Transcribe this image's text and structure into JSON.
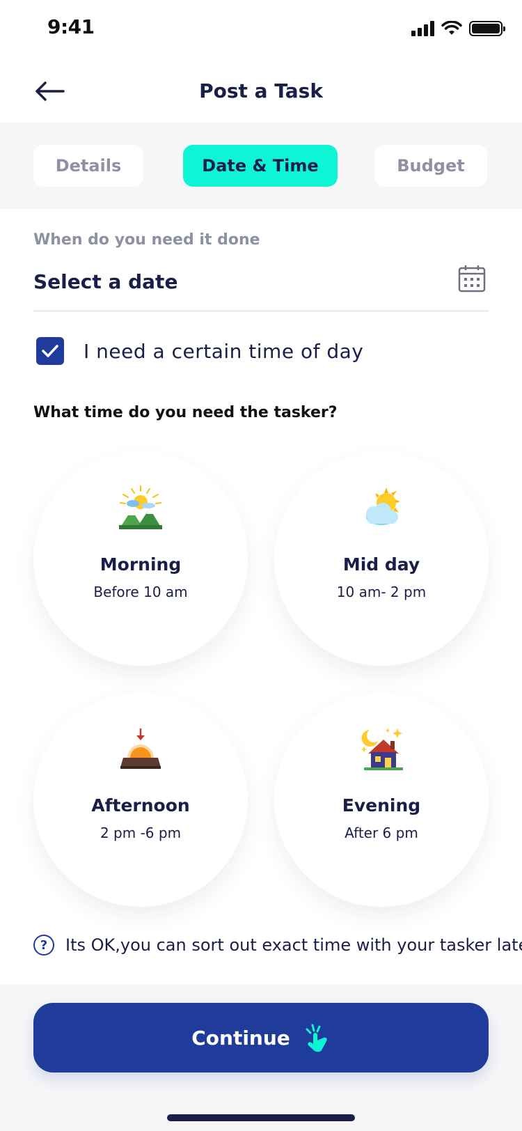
{
  "status_bar": {
    "time": "9:41"
  },
  "nav": {
    "title": "Post a Task"
  },
  "tabs": [
    {
      "label": "Details",
      "active": false
    },
    {
      "label": "Date & Time",
      "active": true
    },
    {
      "label": "Budget",
      "active": false
    }
  ],
  "date_section": {
    "label": "When do you need it done",
    "value": "Select a date"
  },
  "certain_time": {
    "label": "I need a certain time of day",
    "checked": true
  },
  "question": "What time do you need the tasker?",
  "time_options": [
    {
      "title": "Morning",
      "subtitle": "Before 10 am",
      "icon": "sunrise-mountain-icon"
    },
    {
      "title": "Mid day",
      "subtitle": "10 am- 2 pm",
      "icon": "sun-cloud-icon"
    },
    {
      "title": "Afternoon",
      "subtitle": "2 pm -6 pm",
      "icon": "sunset-icon"
    },
    {
      "title": "Evening",
      "subtitle": "After 6 pm",
      "icon": "night-house-icon"
    }
  ],
  "help_text": "Its OK,you can sort out exact time with your tasker later",
  "continue_button": {
    "label": "Continue"
  },
  "colors": {
    "accent": "#0ef5d5",
    "primary": "#1f3c9a",
    "text": "#1a1f4a",
    "muted": "#8e91a3"
  }
}
